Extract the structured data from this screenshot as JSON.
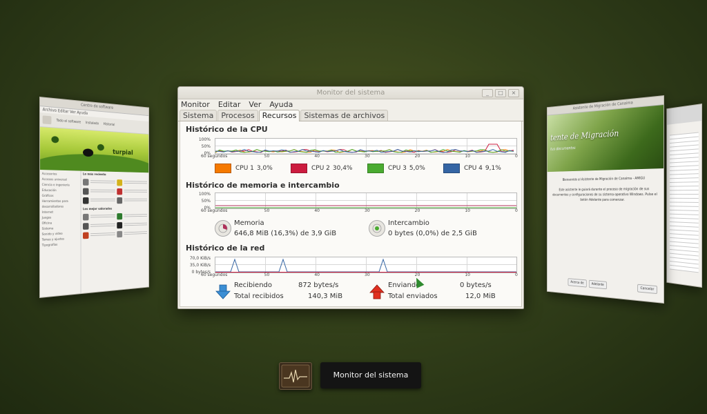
{
  "main_window": {
    "title": "Monitor del sistema",
    "menu": [
      "Monitor",
      "Editar",
      "Ver",
      "Ayuda"
    ],
    "tabs": [
      "Sistema",
      "Procesos",
      "Recursos",
      "Sistemas de archivos"
    ],
    "active_tab": "Recursos",
    "wm_buttons": {
      "minimize": "_",
      "maximize": "□",
      "close": "×"
    }
  },
  "cpu": {
    "heading": "Histórico de la CPU",
    "y_ticks": [
      "100%",
      "50%",
      "0%"
    ],
    "x_ticks": [
      "60 segundos",
      "50",
      "40",
      "30",
      "20",
      "10",
      "0"
    ],
    "legend": [
      {
        "label": "CPU 1",
        "value": "3,0%",
        "color": "#f57900"
      },
      {
        "label": "CPU 2",
        "value": "30,4%",
        "color": "#cc1c3f"
      },
      {
        "label": "CPU 3",
        "value": "5,0%",
        "color": "#4aab31"
      },
      {
        "label": "CPU 4",
        "value": "9,1%",
        "color": "#3465a4"
      }
    ]
  },
  "memory": {
    "heading": "Histórico de memoria e intercambio",
    "y_ticks": [
      "100%",
      "50%",
      "0%"
    ],
    "x_ticks": [
      "60 segundos",
      "50",
      "40",
      "30",
      "20",
      "10",
      "0"
    ],
    "mem_label": "Memoria",
    "mem_value": "646,8 MiB (16,3%) de 3,9 GiB",
    "swap_label": "Intercambio",
    "swap_value": "0 bytes (0,0%) de 2,5 GiB",
    "mem_color": "#b0305a",
    "swap_color": "#4aab31"
  },
  "network": {
    "heading": "Histórico de la red",
    "y_ticks": [
      "70,0 KiB/s",
      "35,0 KiB/s",
      "0 bytes/s"
    ],
    "x_ticks": [
      "60 segundos",
      "50",
      "40",
      "30",
      "20",
      "10",
      "0"
    ],
    "receiving_label": "Recibiendo",
    "receiving_value": "872 bytes/s",
    "total_received_label": "Total recibidos",
    "total_received_value": "140,3 MiB",
    "sending_label": "Enviando",
    "sending_value": "0 bytes/s",
    "total_sent_label": "Total enviados",
    "total_sent_value": "12,0 MiB",
    "recv_color": "#3465a4",
    "send_color": "#cc1c3f"
  },
  "switcher": {
    "label": "Monitor del sistema"
  },
  "left_window": {
    "title": "Centro de software",
    "menu": "Archivo  Editar  Ver  Ayuda",
    "toolbar": [
      "Todo el software",
      "Instalado",
      "Historial"
    ],
    "brand": "turpial",
    "categories": [
      "Accesorios",
      "Accesos universal",
      "Ciencia e ingeniería",
      "Educación",
      "Gráficos",
      "Herramientas para desarrolladores",
      "Internet",
      "Juegos",
      "Oficina",
      "Sistema",
      "Sonido y vídeo",
      "Temas y ajustes",
      "Tipografías"
    ],
    "section_new": "Lo más reciente",
    "section_top": "Los mejor valorados"
  },
  "right_window": {
    "title": "Asistente de Migración de Canaima",
    "banner": "tente de Migración",
    "banner_sub": "tus documentos",
    "welcome": "Bienvenido al Asistente de Migración de Canaima - AMIGU",
    "body": "Este asistente le guiará durante el proceso de migración de sus documentos y configuraciones de su sistema operativo Windows. Pulse el botón Adelante para comenzar.",
    "buttons": [
      "Acerca de",
      "Adelante",
      "Cancelar"
    ]
  }
}
